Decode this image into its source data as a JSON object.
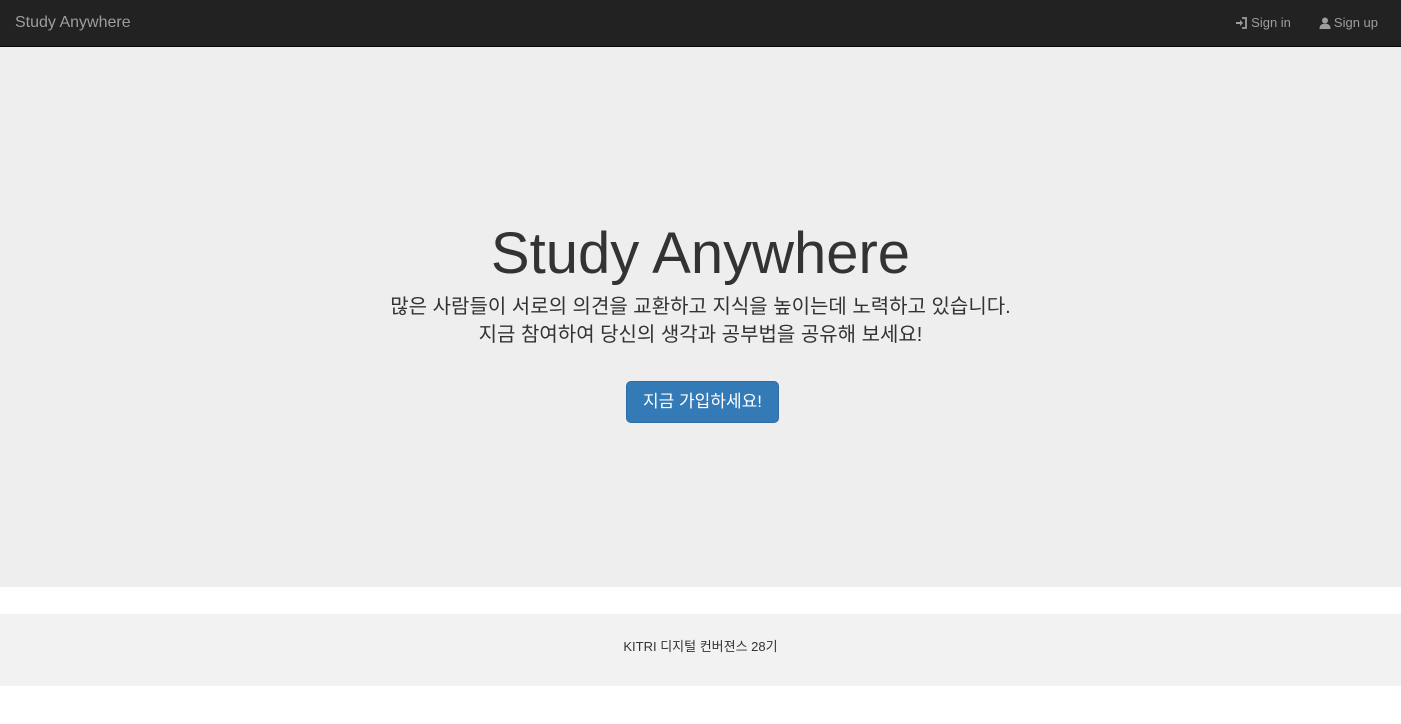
{
  "navbar": {
    "brand": "Study Anywhere",
    "sign_in_label": "Sign in",
    "sign_up_label": "Sign up",
    "sign_in_icon": "log-in-icon",
    "sign_up_icon": "user-icon"
  },
  "hero": {
    "title": "Study Anywhere",
    "lead_line1": "많은 사람들이 서로의 의견을 교환하고 지식을 높이는데 노력하고 있습니다.",
    "lead_line2": "지금 참여하여 당신의 생각과 공부법을 공유해 보세요!",
    "cta_label": "지금 가입하세요!"
  },
  "footer": {
    "text": "KITRI 디지털 컨버젼스 28기"
  },
  "colors": {
    "navbar_bg": "#222222",
    "nav_text": "#9d9d9d",
    "jumbotron_bg": "#eeeeee",
    "primary": "#337ab7",
    "footer_bg": "#f2f2f2"
  }
}
